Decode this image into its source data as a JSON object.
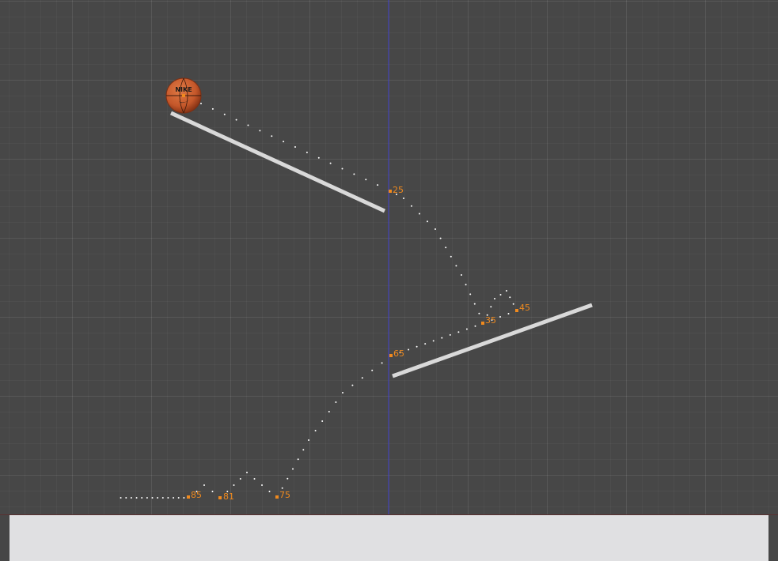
{
  "viewport": {
    "name": "3d-viewport",
    "grid": true,
    "colors": {
      "background": "#474747",
      "axis": "#3d3dc8",
      "ramp": "#d9d9d9",
      "motion_path": "#ffffff",
      "keyframe": "#f08a1e",
      "ball": "#c4572a",
      "ground": "#e0e0e2"
    }
  },
  "ball": {
    "brand": "NIKE",
    "icon": "basketball-icon"
  },
  "keyframes": [
    {
      "label": "25"
    },
    {
      "label": "35"
    },
    {
      "label": "45"
    },
    {
      "label": "65"
    },
    {
      "label": "75"
    },
    {
      "label": "81"
    },
    {
      "label": "85"
    }
  ]
}
